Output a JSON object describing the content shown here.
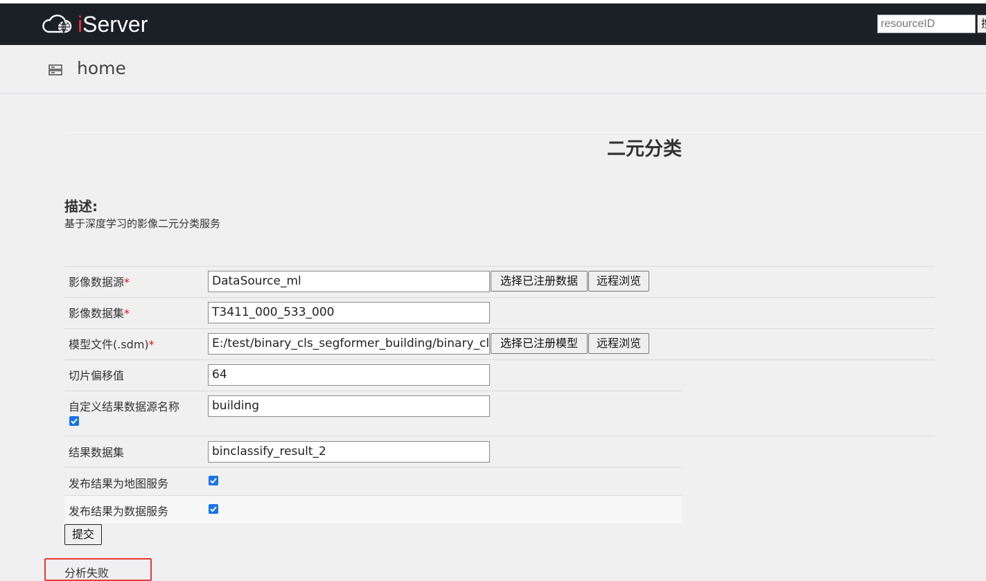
{
  "header": {
    "logo_prefix": "i",
    "logo_suffix": "Server",
    "search_placeholder": "resourceID",
    "search_button": "搜"
  },
  "breadcrumb": {
    "label": "home"
  },
  "page": {
    "title": "二元分类",
    "desc_heading": "描述:",
    "desc_text": "基于深度学习的影像二元分类服务"
  },
  "form": {
    "datasource": {
      "label": "影像数据源",
      "required": "*",
      "value": "DataSource_ml",
      "btn_registered": "选择已注册数据",
      "btn_remote": "远程浏览"
    },
    "dataset": {
      "label": "影像数据集",
      "required": "*",
      "value": "T3411_000_533_000"
    },
    "model": {
      "label": "模型文件(.sdm)",
      "required": "*",
      "value": "E:/test/binary_cls_segformer_building/binary_cls",
      "btn_registered": "选择已注册模型",
      "btn_remote": "远程浏览"
    },
    "offset": {
      "label": "切片偏移值",
      "value": "64"
    },
    "custom_ds": {
      "label": "自定义结果数据源名称",
      "value": "building",
      "checked": true
    },
    "result_dataset": {
      "label": "结果数据集",
      "value": "binclassify_result_2"
    },
    "publish_map": {
      "label": "发布结果为地图服务",
      "checked": true
    },
    "publish_data": {
      "label": "发布结果为数据服务",
      "checked": true
    },
    "submit": "提交"
  },
  "status": {
    "text": "分析失败",
    "highlight_color": "#e53935"
  },
  "colors": {
    "header_bg": "#1b1f26",
    "accent_red": "#e0342c",
    "checkbox_blue": "#1a73e8"
  }
}
